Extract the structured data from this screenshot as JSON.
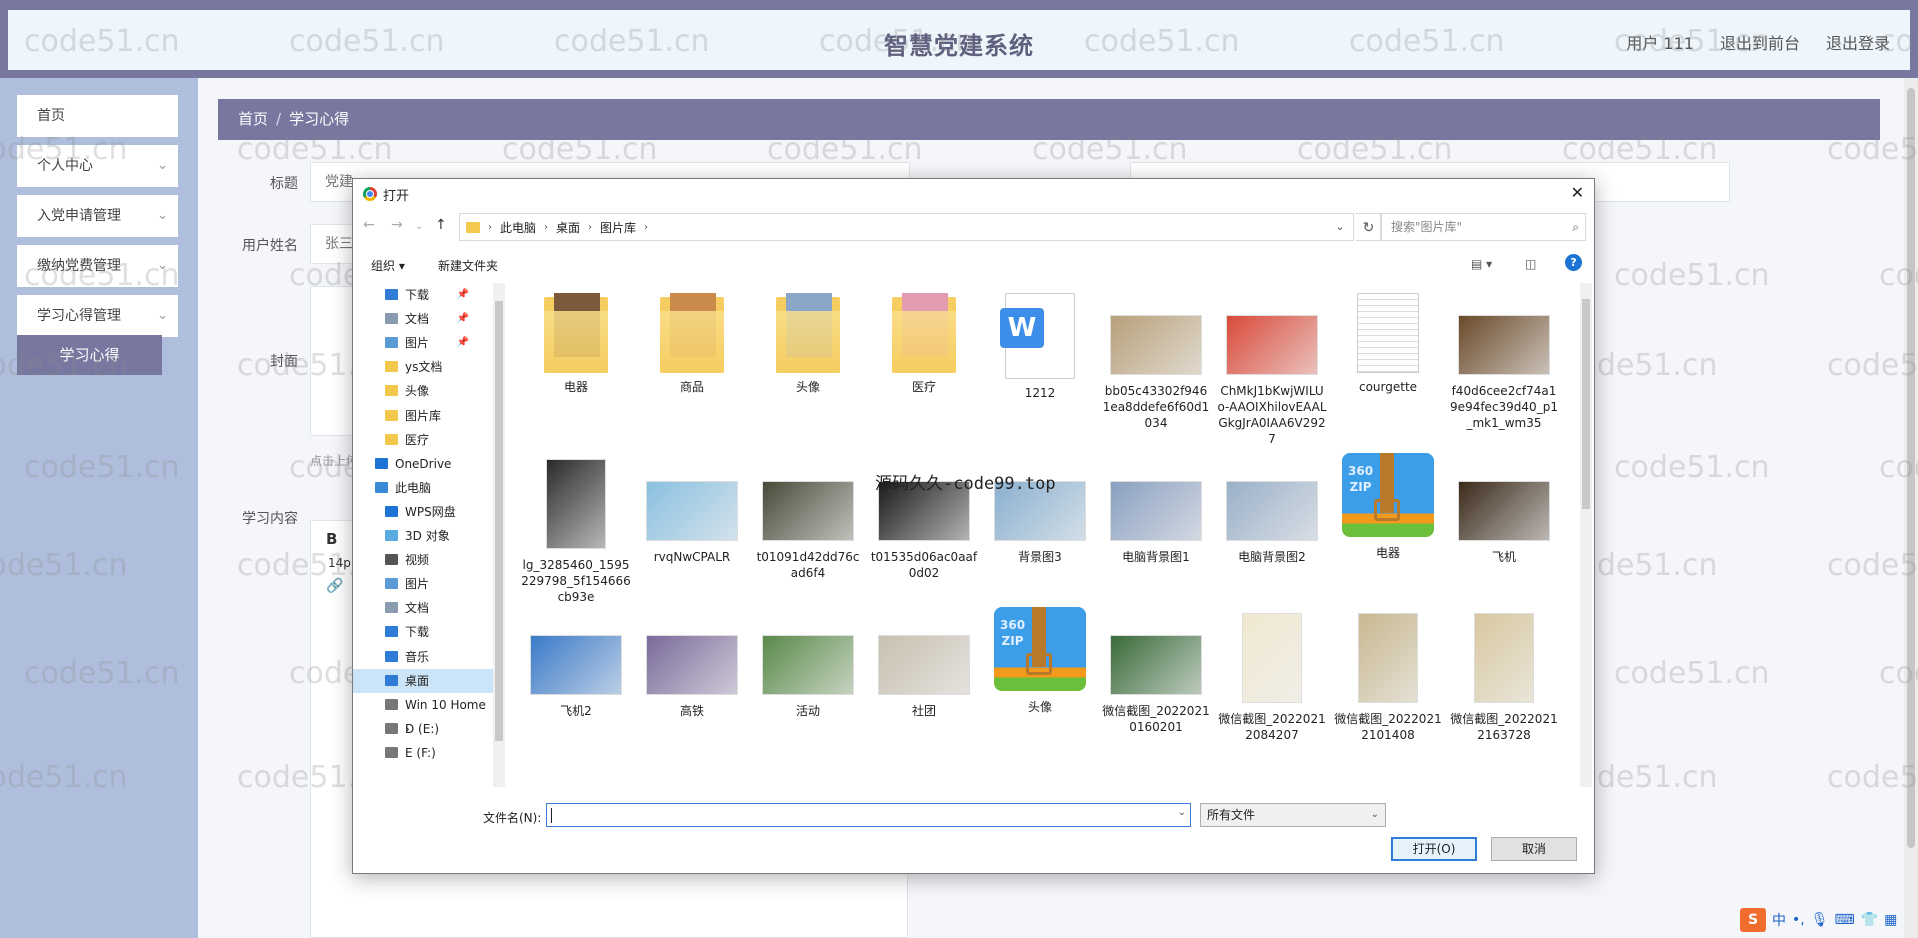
{
  "app": {
    "title": "智慧党建系统",
    "user_label": "用户 111",
    "back_front": "退出到前台",
    "logout": "退出登录"
  },
  "sidebar": {
    "items": [
      {
        "label": "首页",
        "chevron": false
      },
      {
        "label": "个人中心",
        "chevron": true
      },
      {
        "label": "入党申请管理",
        "chevron": true
      },
      {
        "label": "缴纳党费管理",
        "chevron": true
      },
      {
        "label": "学习心得管理",
        "chevron": true
      }
    ],
    "active_sub": "学习心得"
  },
  "breadcrumb": {
    "home": "首页",
    "separator": "/",
    "current": "学习心得"
  },
  "form": {
    "title_label": "标题",
    "title_value": "党建",
    "username_label": "用户姓名",
    "username_value": "张三",
    "cover_label": "封面",
    "upload_hint": "点击上传",
    "content_label": "学习内容",
    "editor_bold": "B",
    "editor_size": "14p"
  },
  "watermark": "code51.cn",
  "source_watermark": "源码久久-code99.top",
  "dialog": {
    "title": "打开",
    "path": [
      "此电脑",
      "桌面",
      "图片库"
    ],
    "search_placeholder": "搜索\"图片库\"",
    "organize": "组织 ▾",
    "new_folder": "新建文件夹",
    "nav": [
      {
        "label": "下载",
        "icon": "download-icon",
        "pinned": true,
        "indent": 1
      },
      {
        "label": "文档",
        "icon": "document-icon",
        "pinned": true,
        "indent": 1
      },
      {
        "label": "图片",
        "icon": "picture-icon",
        "pinned": true,
        "indent": 1
      },
      {
        "label": "ys文档",
        "icon": "folder-icon",
        "pinned": false,
        "indent": 1
      },
      {
        "label": "头像",
        "icon": "folder-icon",
        "pinned": false,
        "indent": 1
      },
      {
        "label": "图片库",
        "icon": "folder-icon",
        "pinned": false,
        "indent": 1
      },
      {
        "label": "医疗",
        "icon": "folder-icon",
        "pinned": false,
        "indent": 1
      },
      {
        "label": "OneDrive",
        "icon": "cloud-icon",
        "pinned": false,
        "indent": 0
      },
      {
        "label": "此电脑",
        "icon": "computer-icon",
        "pinned": false,
        "indent": 0
      },
      {
        "label": "WPS网盘",
        "icon": "cloud-icon",
        "pinned": false,
        "indent": 1
      },
      {
        "label": "3D 对象",
        "icon": "cube-icon",
        "pinned": false,
        "indent": 1
      },
      {
        "label": "视频",
        "icon": "video-icon",
        "pinned": false,
        "indent": 1
      },
      {
        "label": "图片",
        "icon": "picture-icon",
        "pinned": false,
        "indent": 1
      },
      {
        "label": "文档",
        "icon": "document-icon",
        "pinned": false,
        "indent": 1
      },
      {
        "label": "下载",
        "icon": "download-icon",
        "pinned": false,
        "indent": 1
      },
      {
        "label": "音乐",
        "icon": "music-icon",
        "pinned": false,
        "indent": 1
      },
      {
        "label": "桌面",
        "icon": "desktop-icon",
        "pinned": false,
        "indent": 1,
        "selected": true
      },
      {
        "label": "Win 10 Home ›",
        "icon": "drive-icon",
        "pinned": false,
        "indent": 1
      },
      {
        "label": "D (E:)",
        "icon": "drive-icon",
        "pinned": false,
        "indent": 1
      },
      {
        "label": "E (F:)",
        "icon": "drive-icon",
        "pinned": false,
        "indent": 1
      }
    ],
    "files": [
      {
        "name": "电器",
        "kind": "folder",
        "color": "#7a5a3a"
      },
      {
        "name": "商品",
        "kind": "folder",
        "color": "#c98a4a"
      },
      {
        "name": "头像",
        "kind": "folder",
        "color": "#8aa7c9"
      },
      {
        "name": "医疗",
        "kind": "folder",
        "color": "#e39bb0"
      },
      {
        "name": "1212",
        "kind": "word"
      },
      {
        "name": "bb05c43302f9461ea8ddefe6f60d1034",
        "kind": "image",
        "color": "#b8a07a"
      },
      {
        "name": "ChMkJ1bKwjWILUo-AAOIXhilovEAALGkgJrA0IAA6V2927",
        "kind": "image",
        "color": "#d94a3a"
      },
      {
        "name": "courgette",
        "kind": "text"
      },
      {
        "name": "f40d6cee2cf74a19e94fec39d40_p1_mk1_wm35",
        "kind": "image",
        "color": "#6a4a2a"
      },
      {
        "name": "lg_3285460_1595229798_5f154666cb93e",
        "kind": "image",
        "color": "#2a2a2a",
        "tall": true
      },
      {
        "name": "rvqNwCPALR",
        "kind": "image",
        "color": "#8ac0e0"
      },
      {
        "name": "t01091d42dd76cad6f4",
        "kind": "image",
        "color": "#4a4a3a"
      },
      {
        "name": "t01535d06ac0aaf0d02",
        "kind": "image",
        "color": "#1a1a1a"
      },
      {
        "name": "背景图3",
        "kind": "image",
        "color": "#8ab0d0"
      },
      {
        "name": "电脑背景图1",
        "kind": "image",
        "color": "#8aa0c0"
      },
      {
        "name": "电脑背景图2",
        "kind": "image",
        "color": "#9ab0c8"
      },
      {
        "name": "电器",
        "kind": "zip"
      },
      {
        "name": "飞机",
        "kind": "image",
        "color": "#3a2a1a"
      },
      {
        "name": "飞机2",
        "kind": "image",
        "color": "#3a7ac8"
      },
      {
        "name": "高铁",
        "kind": "image",
        "color": "#7a6a9a"
      },
      {
        "name": "活动",
        "kind": "image",
        "color": "#5a8a4a"
      },
      {
        "name": "社团",
        "kind": "image",
        "color": "#c8c0b0"
      },
      {
        "name": "头像",
        "kind": "zip"
      },
      {
        "name": "微信截图_20220210160201",
        "kind": "image",
        "color": "#3a6a3a"
      },
      {
        "name": "微信截图_20220212084207",
        "kind": "image",
        "color": "#f0e8d0",
        "tall": true
      },
      {
        "name": "微信截图_20220212101408",
        "kind": "image",
        "color": "#c8b890",
        "tall": true
      },
      {
        "name": "微信截图_20220212163728",
        "kind": "image",
        "color": "#d8c8a0",
        "tall": true
      }
    ],
    "filename_label": "文件名(N):",
    "filetype": "所有文件",
    "open_button": "打开(O)",
    "cancel_button": "取消"
  },
  "tray": {
    "ime": "S",
    "lang": "中"
  },
  "colors": {
    "accent": "#7777a0",
    "sidebar": "#aebedc",
    "selection": "#cce4f7",
    "dialog_button": "#2f7bd8"
  }
}
